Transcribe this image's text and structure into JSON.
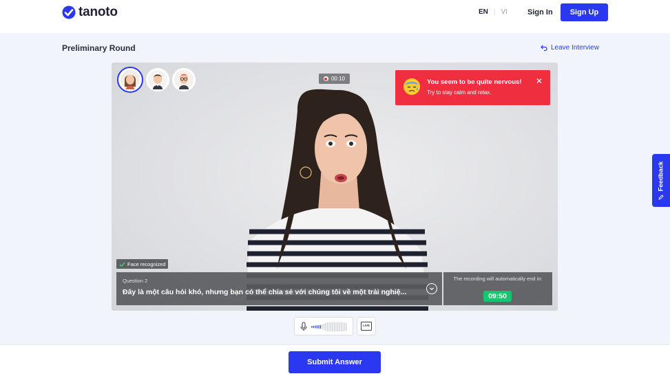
{
  "brand": {
    "name": "tanoto",
    "color": "#2a38f0"
  },
  "header": {
    "lang_en": "EN",
    "lang_vi": "VI",
    "sign_in": "Sign In",
    "sign_up": "Sign Up"
  },
  "page": {
    "title": "Preliminary Round",
    "leave_label": "Leave Interview",
    "leave_icon": "undo-arrow-icon"
  },
  "video": {
    "recording_time": "00:10",
    "participants": [
      "woman-avatar",
      "man-avatar",
      "man-glasses-avatar"
    ],
    "alert": {
      "title": "You seem to be quite nervous!",
      "subtitle": "Try to stay calm and relax.",
      "close_icon": "close-icon",
      "color": "#ef2e40"
    },
    "face_status": "Face recognized",
    "question": {
      "label": "Question 2",
      "text": "Đây là một câu hỏi khó, nhưng bạn có thể chia sẻ với chúng tôi về một trải nghiệ..."
    },
    "timer": {
      "note": "The recording will automatically end in:",
      "value": "09:50",
      "color": "#16c56e"
    }
  },
  "controls": {
    "mic_icon": "microphone-icon",
    "live_label": "LIVE"
  },
  "feedback_label": "Feedback",
  "footer": {
    "submit_label": "Submit Answer"
  }
}
